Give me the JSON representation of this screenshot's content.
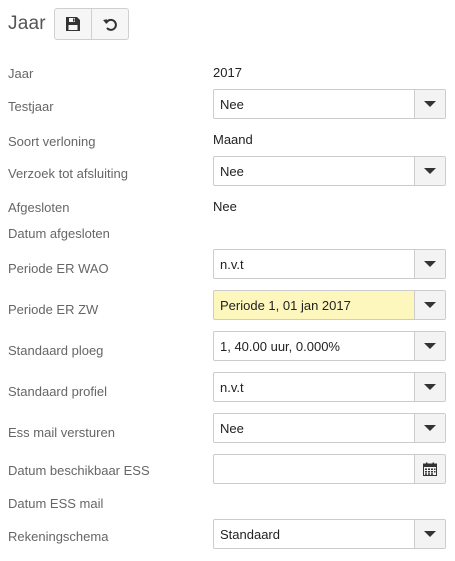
{
  "header": {
    "title": "Jaar",
    "icons": {
      "save": "save-icon",
      "undo": "undo-icon"
    }
  },
  "fields": {
    "jaar": {
      "label": "Jaar",
      "value": "2017"
    },
    "testjaar": {
      "label": "Testjaar",
      "value": "Nee"
    },
    "soort_verloning": {
      "label": "Soort verloning",
      "value": "Maand"
    },
    "verzoek_tot_afsluiting": {
      "label": "Verzoek tot afsluiting",
      "value": "Nee"
    },
    "afgesloten": {
      "label": "Afgesloten",
      "value": "Nee"
    },
    "datum_afgesloten": {
      "label": "Datum afgesloten",
      "value": ""
    },
    "periode_er_wao": {
      "label": "Periode ER WAO",
      "value": "n.v.t"
    },
    "periode_er_zw": {
      "label": "Periode ER ZW",
      "value": "Periode 1, 01 jan 2017"
    },
    "standaard_ploeg": {
      "label": "Standaard ploeg",
      "value": "1, 40.00 uur, 0.000%"
    },
    "standaard_profiel": {
      "label": "Standaard profiel",
      "value": "n.v.t"
    },
    "ess_mail_versturen": {
      "label": "Ess mail versturen",
      "value": "Nee"
    },
    "datum_beschikbaar_ess": {
      "label": "Datum beschikbaar ESS",
      "value": ""
    },
    "datum_ess_mail": {
      "label": "Datum ESS mail",
      "value": ""
    },
    "rekeningschema": {
      "label": "Rekeningschema",
      "value": "Standaard"
    }
  },
  "colors": {
    "highlight": "#fdf6bd",
    "border": "#cccccc",
    "label": "#666666"
  }
}
